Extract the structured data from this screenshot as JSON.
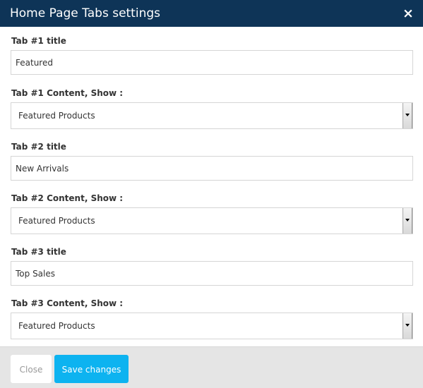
{
  "modal": {
    "title": "Home Page Tabs settings",
    "close_glyph": "×"
  },
  "fields": {
    "tab1_title": {
      "label": "Tab #1 title",
      "value": "Featured"
    },
    "tab1_content": {
      "label": "Tab #1 Content, Show :",
      "selected": "Featured Products"
    },
    "tab2_title": {
      "label": "Tab #2 title",
      "value": "New Arrivals"
    },
    "tab2_content": {
      "label": "Tab #2 Content, Show :",
      "selected": "Featured Products"
    },
    "tab3_title": {
      "label": "Tab #3 title",
      "value": "Top Sales"
    },
    "tab3_content": {
      "label": "Tab #3 Content, Show :",
      "selected": "Featured Products"
    }
  },
  "footer": {
    "close_label": "Close",
    "save_label": "Save changes"
  },
  "colors": {
    "header_bg": "#0e3457",
    "save_button": "#0db3f0",
    "footer_bg": "#e5e5e5"
  },
  "icons": {
    "close": "close-icon",
    "select_arrow": "chevron-down-icon"
  }
}
